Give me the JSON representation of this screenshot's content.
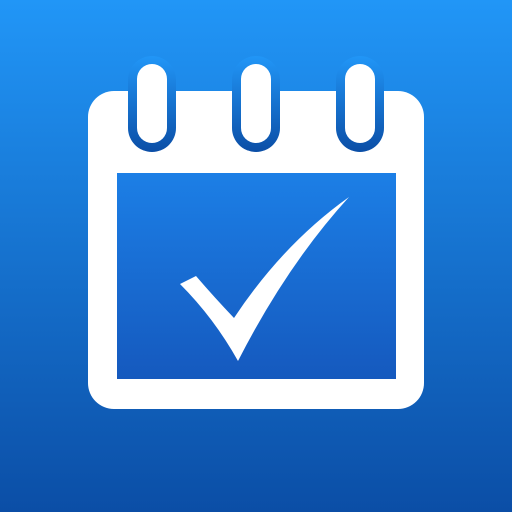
{
  "icon": {
    "name": "calendar-check-icon",
    "glyphs": [
      "calendar-icon",
      "checkmark-icon"
    ]
  },
  "colors": {
    "background_top": "#2196F7",
    "background_bottom": "#0B4EA6",
    "glyph": "#FFFFFF",
    "calendar_face_top": "#1C7FE6",
    "calendar_face_bottom": "#1559BE"
  }
}
